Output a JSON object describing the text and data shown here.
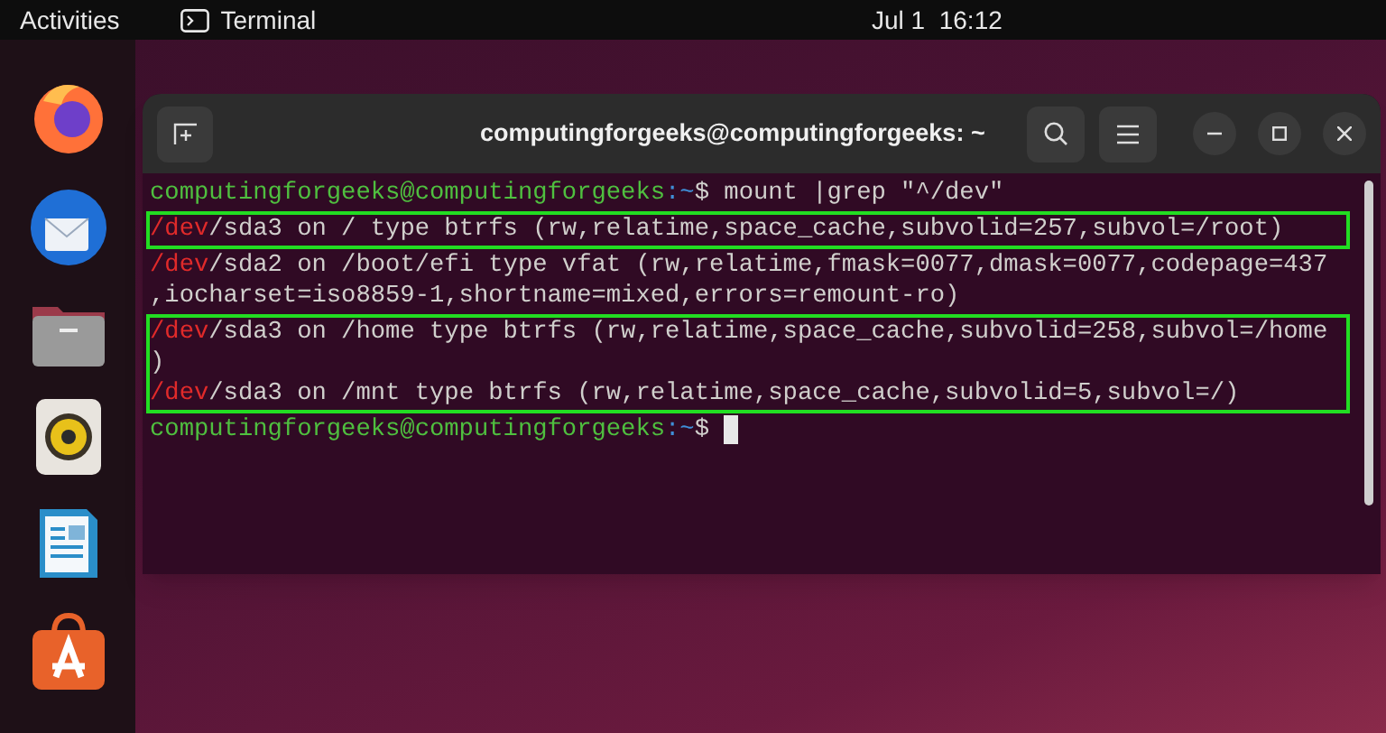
{
  "top_bar": {
    "activities": "Activities",
    "app": "Terminal",
    "clock": "Jul 1  16:12"
  },
  "dock": [
    {
      "kind": "firefox"
    },
    {
      "kind": "mail"
    },
    {
      "kind": "files"
    },
    {
      "kind": "speaker"
    },
    {
      "kind": "document"
    },
    {
      "kind": "store"
    }
  ],
  "terminal": {
    "title": "computingforgeeks@computingforgeeks: ~",
    "blocks": [
      {
        "highlighted": false,
        "lines": [
          {
            "kind": "prompt",
            "user": "computingforgeeks@computingforgeeks",
            "path": ":~",
            "command": "$ mount |grep \"^/dev\"",
            "cursor": false
          }
        ]
      },
      {
        "highlighted": true,
        "lines": [
          {
            "kind": "output",
            "match": "/dev",
            "rest": "/sda3 on / type btrfs (rw,relatime,space_cache,subvolid=257,subvol=/root)"
          }
        ]
      },
      {
        "highlighted": false,
        "lines": [
          {
            "kind": "output",
            "match": "/dev",
            "rest": "/sda2 on /boot/efi type vfat (rw,relatime,fmask=0077,dmask=0077,codepage=437"
          },
          {
            "kind": "output",
            "rest": ",iocharset=iso8859-1,shortname=mixed,errors=remount-ro)"
          }
        ]
      },
      {
        "highlighted": true,
        "lines": [
          {
            "kind": "output",
            "match": "/dev",
            "rest": "/sda3 on /home type btrfs (rw,relatime,space_cache,subvolid=258,subvol=/home"
          },
          {
            "kind": "output",
            "rest": ")"
          },
          {
            "kind": "output",
            "match": "/dev",
            "rest": "/sda3 on /mnt type btrfs (rw,relatime,space_cache,subvolid=5,subvol=/)"
          }
        ]
      },
      {
        "highlighted": false,
        "lines": [
          {
            "kind": "prompt",
            "user": "computingforgeeks@computingforgeeks",
            "path": ":~",
            "command": "$ ",
            "cursor": true
          }
        ]
      }
    ]
  }
}
